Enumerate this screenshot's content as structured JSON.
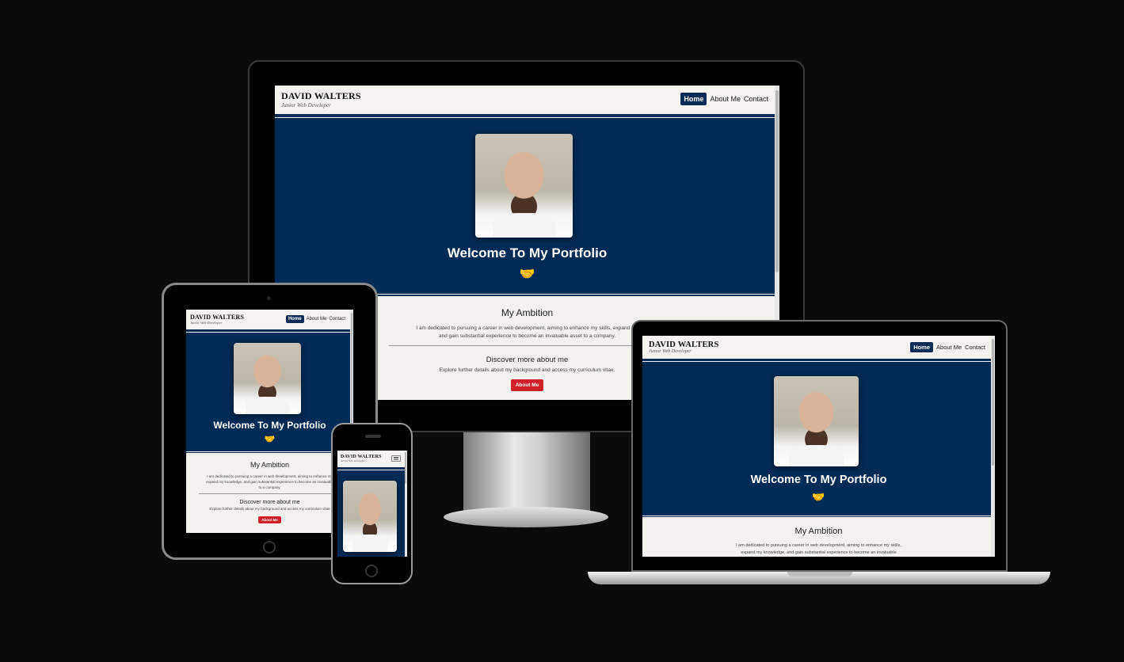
{
  "site": {
    "brand_name": "DAVID WALTERS",
    "brand_tagline": "Junior Web Developer",
    "nav": [
      "Home",
      "About Me",
      "Contact"
    ],
    "hero_title": "Welcome To My Portfolio",
    "hero_icon": "handshake-icon",
    "ambition_title": "My Ambition",
    "ambition_text_full": "I am dedicated to pursuing a career in web development, aiming to enhance my skills, expand my knowledge, and gain substantial experience to become an invaluable asset to a company.",
    "ambition_line1_monitor": "I am dedicated to pursuing a career in web development, aiming to enhance my skills, expand my",
    "ambition_line2_monitor": "and gain substantial experience to become an invaluable asset to a company.",
    "ambition_line1_laptop": "I am dedicated to pursuing a career in web development, aiming to enhance my skills,",
    "ambition_line2_laptop": "expand my knowledge, and gain substantial experience to become an invaluable",
    "ambition_line1_tablet": "I am dedicated to pursuing a career in web development, aiming to enhance my",
    "ambition_line2_tablet": "expand my knowledge, and gain substantial experience to become an invaluable",
    "ambition_line3_tablet": "to a company.",
    "discover_title": "Discover more about me",
    "discover_text": "Explore further details about my background and access my curriculum vitae.",
    "discover_text_tablet": "Explore further details about my background and access my curriculum vitae",
    "button_label": "About Me"
  },
  "colors": {
    "hero_bg": "#002b56",
    "nav_active": "#0d2c57",
    "button": "#d0202a",
    "page_bg": "#f2f1ee",
    "background": "#0b0b0b"
  },
  "phone": {
    "menu_icon": "hamburger-menu-icon"
  }
}
